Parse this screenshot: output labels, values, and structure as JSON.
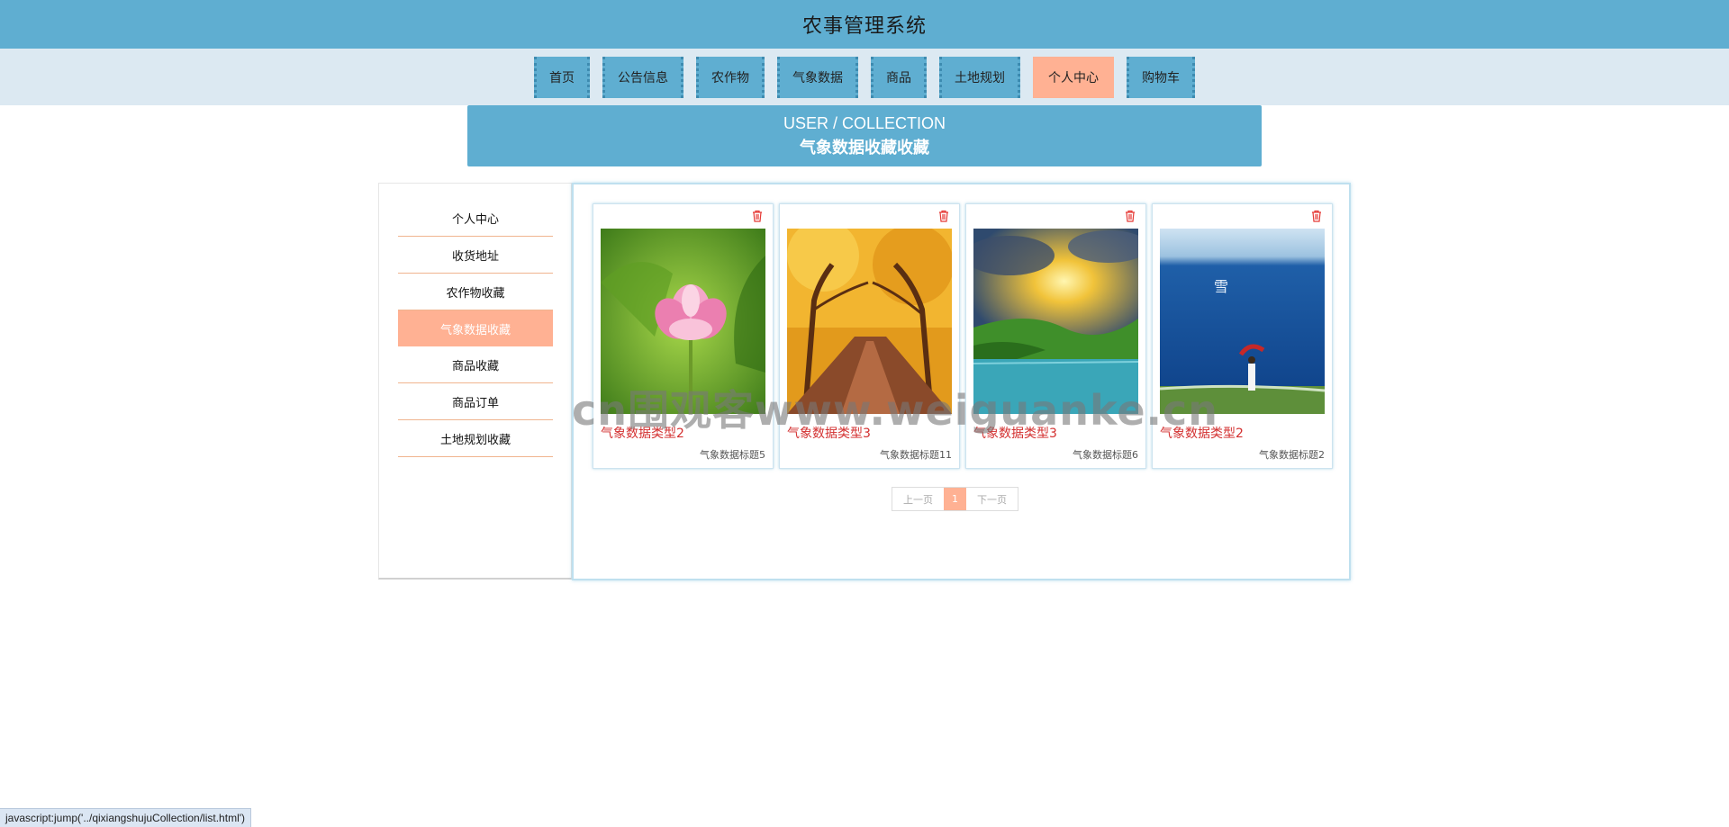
{
  "header": {
    "title": "农事管理系统"
  },
  "nav": {
    "items": [
      {
        "label": "首页"
      },
      {
        "label": "公告信息"
      },
      {
        "label": "农作物"
      },
      {
        "label": "气象数据"
      },
      {
        "label": "商品"
      },
      {
        "label": "土地规划"
      },
      {
        "label": "个人中心",
        "active": true
      },
      {
        "label": "购物车"
      }
    ]
  },
  "banner": {
    "en": "USER / COLLECTION",
    "cn": "气象数据收藏收藏"
  },
  "sidebar": {
    "items": [
      {
        "label": "个人中心"
      },
      {
        "label": "收货地址"
      },
      {
        "label": "农作物收藏"
      },
      {
        "label": "气象数据收藏",
        "active": true
      },
      {
        "label": "商品收藏"
      },
      {
        "label": "商品订单"
      },
      {
        "label": "土地规划收藏"
      }
    ]
  },
  "cards": [
    {
      "title": "气象数据类型2",
      "subtitle": "气象数据标题5",
      "image": "lotus"
    },
    {
      "title": "气象数据类型3",
      "subtitle": "气象数据标题11",
      "image": "autumn-trees"
    },
    {
      "title": "气象数据类型3",
      "subtitle": "气象数据标题6",
      "image": "sunset-lake"
    },
    {
      "title": "气象数据类型2",
      "subtitle": "气象数据标题2",
      "image": "sea-umbrella"
    }
  ],
  "pagination": {
    "prev": "上一页",
    "current": "1",
    "next": "下一页"
  },
  "watermark": "cn围观客www.weiguanke.cn",
  "status_url": "javascript:jump('../qixiangshujuCollection/list.html')",
  "colors": {
    "primary": "#5faed1",
    "accent": "#ffb193",
    "nav_bg": "#dce9f2",
    "title_red": "#d32f2f"
  }
}
